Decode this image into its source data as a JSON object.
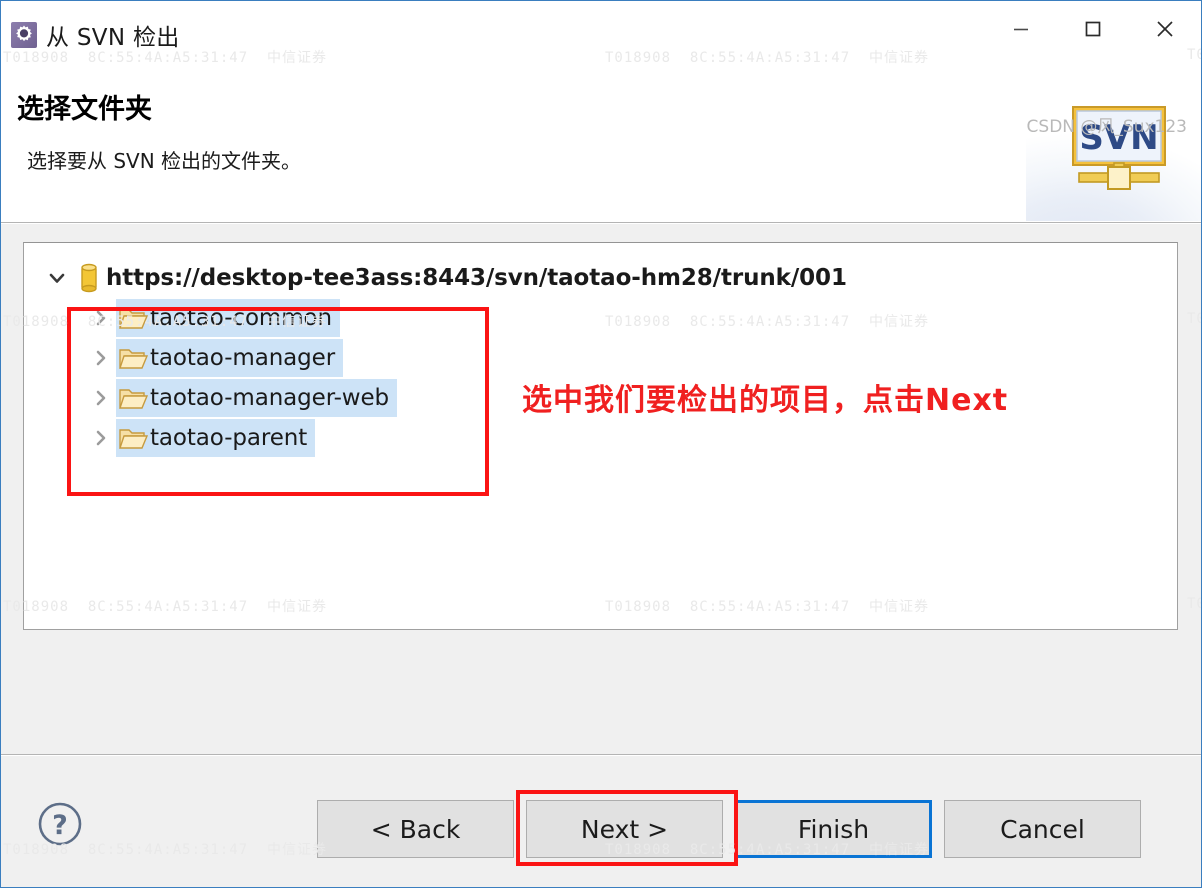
{
  "window": {
    "title": "从 SVN 检出",
    "icon": "gear-icon",
    "minimize_label": "—",
    "maximize_label": "□",
    "close_label": "✕"
  },
  "header": {
    "title": "选择文件夹",
    "subtitle": "选择要从 SVN 检出的文件夹。",
    "banner_logo_text": "SVN"
  },
  "tree": {
    "root": {
      "label": "https://desktop-tee3ass:8443/svn/taotao-hm28/trunk/001",
      "icon": "repository-icon",
      "expanded": true,
      "twisty": "chevron-down-icon"
    },
    "children": [
      {
        "label": "taotao-common",
        "icon": "folder-icon",
        "twisty": "chevron-right-icon",
        "selected": true
      },
      {
        "label": "taotao-manager",
        "icon": "folder-icon",
        "twisty": "chevron-right-icon",
        "selected": true
      },
      {
        "label": "taotao-manager-web",
        "icon": "folder-icon",
        "twisty": "chevron-right-icon",
        "selected": true
      },
      {
        "label": "taotao-parent",
        "icon": "folder-icon",
        "twisty": "chevron-right-icon",
        "selected": true
      }
    ]
  },
  "annotation": {
    "text": "选中我们要检出的项目，点击Next",
    "color": "#f02020"
  },
  "footer": {
    "help_label": "?",
    "buttons": [
      {
        "label": "< Back",
        "name": "back-button",
        "focused": false
      },
      {
        "label": "Next >",
        "name": "next-button",
        "focused": false
      },
      {
        "label": "Finish",
        "name": "finish-button",
        "focused": true
      },
      {
        "label": "Cancel",
        "name": "cancel-button",
        "focused": false
      }
    ]
  },
  "credit": "CSDN @风_Sux123",
  "watermark": {
    "id": "T018908",
    "mac": "8C:55:4A:A5:31:47",
    "org": "中信证券"
  },
  "colors": {
    "accent": "#0a74d4",
    "selection": "#cde3f7",
    "annotation_red": "#fb1414",
    "dialog_bg": "#f0f0f0",
    "title_icon": "#7d6e9e"
  }
}
